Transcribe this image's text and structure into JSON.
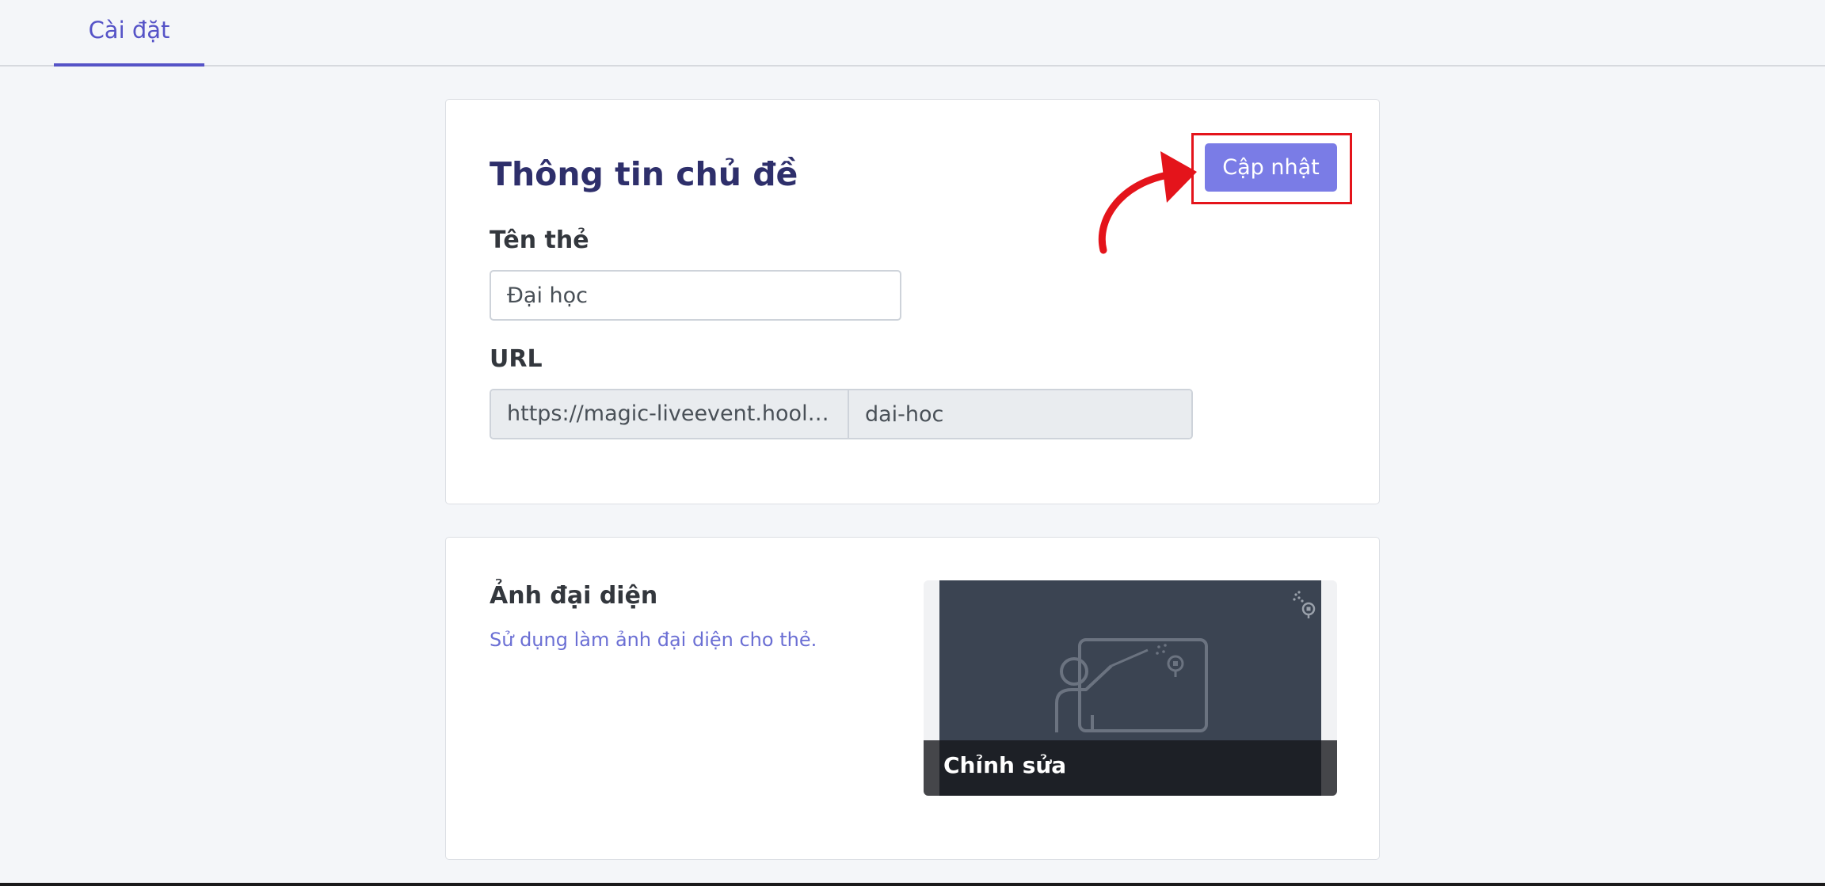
{
  "tabs": {
    "settings_label": "Cài đặt"
  },
  "topic_info": {
    "title": "Thông tin chủ đề",
    "update_label": "Cập nhật",
    "name_label": "Tên thẻ",
    "name_value": "Đại học",
    "url_label": "URL",
    "url_prefix": "https://magic-liveevent.hoola...",
    "url_slug": "dai-hoc"
  },
  "avatar": {
    "title": "Ảnh đại diện",
    "description": "Sử dụng làm ảnh đại diện cho thẻ.",
    "edit_label": "Chỉnh sửa"
  },
  "colors": {
    "accent": "#5553c7",
    "button": "#7a7ce6",
    "annotation": "#e4141b"
  }
}
